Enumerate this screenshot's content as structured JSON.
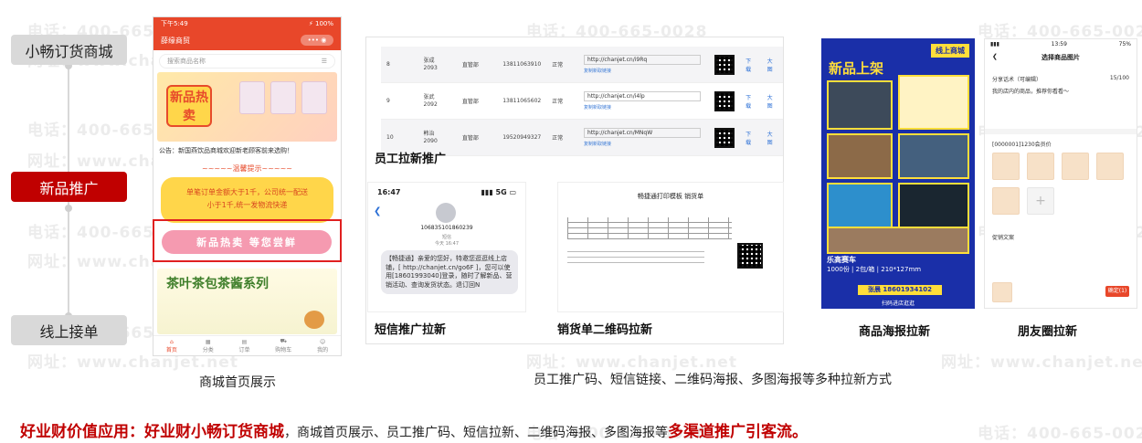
{
  "watermark": {
    "phone": "电话：400-665-0028",
    "site": "网址：www.chanjet.net"
  },
  "timeline": {
    "steps": [
      "小畅订货商城",
      "新品推广",
      "线上接单"
    ]
  },
  "mall_phone": {
    "status_time": "下午5:49",
    "status_right": "⚡ 100%",
    "nav_title": "薛缘商贸",
    "capsule": "••• ◉",
    "search_placeholder": "搜索商品名称",
    "banner_tag": "新品热卖",
    "notice": "公告：新国燕饮品商城欢迎新老顾客前来选购！",
    "tip_title": "~~~~~温馨提示~~~~~",
    "tip_line1": "单笔订单金额大于1千，公司统一配送",
    "tip_line2": "小于1千,统一发物流快递",
    "pill": "新品热卖 等您尝鲜",
    "tea_title": "茶叶茶包茶酱系列",
    "tabs": [
      "首页",
      "分类",
      "订单",
      "购物车",
      "我的"
    ]
  },
  "staff_table": {
    "rows": [
      {
        "no": "8",
        "name": "张成",
        "code": "2093",
        "dept": "直管部",
        "phone": "13811063910",
        "status": "正常",
        "link": "http://chanjet.cn/i9Rq",
        "copy": "复制新取链接",
        "download": "下载",
        "zoom": "大图"
      },
      {
        "no": "9",
        "name": "张武",
        "code": "2092",
        "dept": "直管部",
        "phone": "13811065602",
        "status": "正常",
        "link": "http://chanjet.cn/i4lp",
        "copy": "复制新取链接",
        "download": "下载",
        "zoom": "大图"
      },
      {
        "no": "10",
        "name": "韩治",
        "code": "2090",
        "dept": "直管部",
        "phone": "19520949327",
        "status": "正常",
        "link": "http://chanjet.cn/MNqW",
        "copy": "复制新取链接",
        "download": "下载",
        "zoom": "大图"
      }
    ]
  },
  "labels": {
    "staff": "员工拉新推广",
    "sms": "短信推广拉新",
    "ticket": "销货单二维码拉新",
    "poster": "商品海报拉新",
    "friend": "朋友圈拉新",
    "mall": "商城首页展示",
    "methods": "员工推广码、短信链接、二维码海报、多图海报等多种拉新方式"
  },
  "sms": {
    "time": "16:47",
    "signal": "▮▮▮ 5G ▭",
    "sender": "106835101860239",
    "meta": "短信\n今天 16:47",
    "body": "【畅捷通】亲爱的您好，特邀您逛逛线上店铺，[ http://chanjet.cn/go6F ]，您可以使用[18601993040]登录，随时了解新品、营销活动、查询发货状态。退订回N"
  },
  "ticket": {
    "title": "畅捷通打印模板 销货单"
  },
  "poster": {
    "tag": "线上商城",
    "headline": "新品上架",
    "product": "乐高赛车",
    "spec": "1000份 | 2包/箱 | 210*127mm",
    "phone": "张晨 18601934102",
    "scan": "扫码进店逛逛"
  },
  "friend": {
    "time": "13:59",
    "battery": "75%",
    "header": "选择商品图片",
    "copy_label": "分享话术（可编辑）",
    "copy_count": "15/100",
    "copy_text": "我的店内的商品，推荐你看看～",
    "member": "[0000001]1230会员价",
    "promo": "促销文案",
    "button": "确定(1)"
  },
  "bottom": {
    "lead": "好业财价值应用：好业财小畅订货商城",
    "middle": "，商城首页展示、员工推广码、短信拉新、二维码海报、多图海报等",
    "tail": "多渠道推广引客流。"
  }
}
